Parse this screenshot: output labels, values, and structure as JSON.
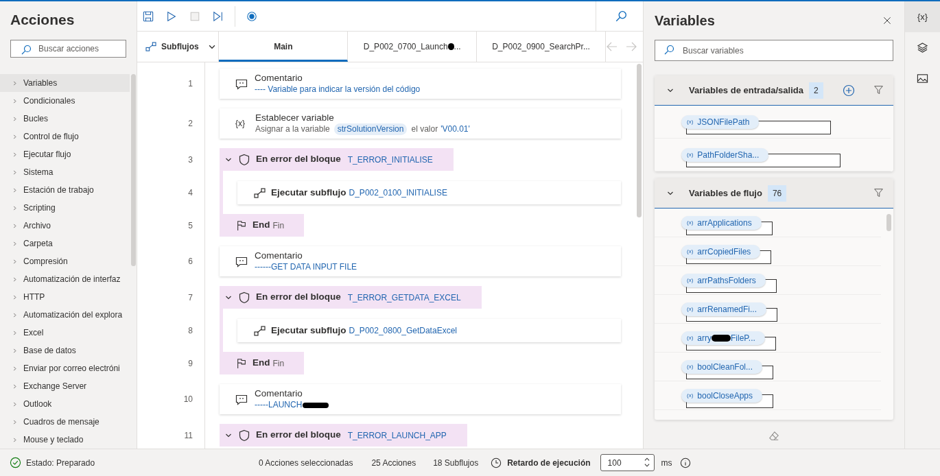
{
  "actions_panel": {
    "title": "Acciones",
    "search": {
      "placeholder": "Buscar acciones"
    },
    "categories": [
      {
        "label": "Variables",
        "selected": true
      },
      {
        "label": "Condicionales",
        "selected": false
      },
      {
        "label": "Bucles",
        "selected": false
      },
      {
        "label": "Control de flujo",
        "selected": false
      },
      {
        "label": "Ejecutar flujo",
        "selected": false
      },
      {
        "label": "Sistema",
        "selected": false
      },
      {
        "label": "Estación de trabajo",
        "selected": false
      },
      {
        "label": "Scripting",
        "selected": false
      },
      {
        "label": "Archivo",
        "selected": false
      },
      {
        "label": "Carpeta",
        "selected": false
      },
      {
        "label": "Compresión",
        "selected": false
      },
      {
        "label": "Automatización de interfaz",
        "selected": false
      },
      {
        "label": "HTTP",
        "selected": false
      },
      {
        "label": "Automatización del explora",
        "selected": false
      },
      {
        "label": "Excel",
        "selected": false
      },
      {
        "label": "Base de datos",
        "selected": false
      },
      {
        "label": "Enviar por correo electróni",
        "selected": false
      },
      {
        "label": "Exchange Server",
        "selected": false
      },
      {
        "label": "Outlook",
        "selected": false
      },
      {
        "label": "Cuadros de mensaje",
        "selected": false
      },
      {
        "label": "Mouse y teclado",
        "selected": false
      }
    ]
  },
  "toolbar": {
    "buttons": [
      {
        "kind": "save",
        "disabled": false
      },
      {
        "kind": "run",
        "disabled": false
      },
      {
        "kind": "stop",
        "disabled": true
      },
      {
        "kind": "step",
        "disabled": false
      },
      {
        "kind": "record",
        "disabled": false
      }
    ]
  },
  "subflows_button": {
    "label": "Subflujos"
  },
  "tabs": [
    {
      "label": "Main",
      "selected": true
    },
    {
      "label": "D_P002_0700_Launch",
      "redacted": true,
      "label_end": "..."
    },
    {
      "label": "D_P002_0900_SearchPr...",
      "selected": false
    }
  ],
  "steps": [
    {
      "kind": "comment",
      "number": "1",
      "title": "Comentario",
      "text": "---- Variable para indicar la versión del código"
    },
    {
      "kind": "set_variable",
      "number": "2",
      "icon_text": "{x}",
      "title": "Establecer variable",
      "prefix": "Asignar a la variable",
      "variable": "strSolutionVersion",
      "middle": "el valor",
      "value": "'V00.01'"
    },
    {
      "kind": "on_error",
      "number": "3",
      "title": "En error del bloque",
      "block": "T_ERROR_INITIALISE",
      "expanded": true
    },
    {
      "kind": "run_subflow",
      "number": "4",
      "title": "Ejecutar subflujo",
      "subflow": "D_P002_0100_INITIALISE"
    },
    {
      "kind": "end",
      "number": "5",
      "title": "End",
      "subtitle": "Fin"
    },
    {
      "kind": "comment",
      "number": "6",
      "title": "Comentario",
      "text": "------GET DATA INPUT FILE"
    },
    {
      "kind": "on_error",
      "number": "7",
      "title": "En error del bloque",
      "block": "T_ERROR_GETDATA_EXCEL",
      "expanded": true
    },
    {
      "kind": "run_subflow",
      "number": "8",
      "title": "Ejecutar subflujo",
      "subflow": "D_P002_0800_GetDataExcel"
    },
    {
      "kind": "end",
      "number": "9",
      "title": "End",
      "subtitle": "Fin"
    },
    {
      "kind": "comment",
      "number": "10",
      "title": "Comentario",
      "text": "-----LAUNCH",
      "redacted": true
    },
    {
      "kind": "on_error",
      "number": "11",
      "title": "En error del bloque",
      "block": "T_ERROR_LAUNCH_APP",
      "expanded": true
    }
  ],
  "variables_panel": {
    "title": "Variables",
    "search": {
      "placeholder": "Buscar variables"
    },
    "sections": [
      {
        "kind": "io",
        "title": "Variables de entrada/salida",
        "count": "2",
        "expanded": true,
        "can_add": true,
        "variables": [
          {
            "icon_text": "(x)",
            "name": "JSONFilePath"
          },
          {
            "icon_text": "(x)",
            "name": "PathFolderSha..."
          }
        ]
      },
      {
        "kind": "flow",
        "title": "Variables de flujo",
        "count": "76",
        "expanded": true,
        "can_add": false,
        "variables": [
          {
            "icon_text": "(x)",
            "name": "arrApplications"
          },
          {
            "icon_text": "(x)",
            "name": "arrCopiedFiles"
          },
          {
            "icon_text": "(x)",
            "name": "arrPathsFolders"
          },
          {
            "icon_text": "(x)",
            "name": "arrRenamedFi..."
          },
          {
            "icon_text": "(x)",
            "name": "arry",
            "redacted": true,
            "name_end": "FileP..."
          },
          {
            "icon_text": "(x)",
            "name": "boolCleanFol..."
          },
          {
            "icon_text": "(x)",
            "name": "boolCloseApps"
          }
        ]
      }
    ]
  },
  "side_rail": [
    {
      "kind": "variables",
      "glyph": "{x}",
      "selected": true
    },
    {
      "kind": "layers",
      "selected": false
    },
    {
      "kind": "images",
      "selected": false
    }
  ],
  "status_bar": {
    "status": "Estado: Preparado",
    "selected_count": "0 Acciones seleccionadas",
    "actions_count": "25 Acciones",
    "subflows_count": "18 Subflujos",
    "delay_label": "Retardo de ejecución",
    "delay_value": "100",
    "delay_unit": "ms"
  }
}
